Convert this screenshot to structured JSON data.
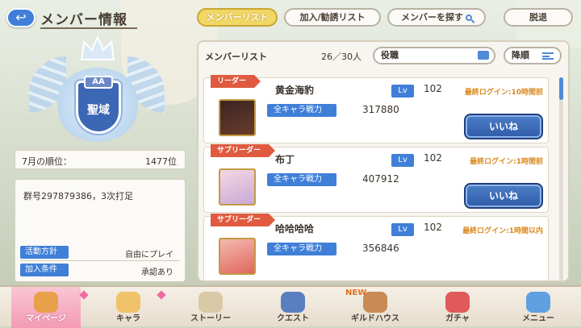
{
  "header": {
    "title": "メンバー情報",
    "tabs": [
      {
        "label": "メンバーリスト",
        "active": true
      },
      {
        "label": "加入/勧誘リスト",
        "active": false
      },
      {
        "label": "メンバーを探す",
        "active": false
      }
    ],
    "leave_label": "脱退"
  },
  "clan": {
    "grade": "AA",
    "rank_name": "聖域",
    "rank_label": "7月の順位：",
    "rank_value": "1477位",
    "description": "群号297879386，3次打足",
    "policy_label": "活動方針",
    "policy_value": "自由にプレイ",
    "condition_label": "加入条件",
    "condition_value": "承認あり"
  },
  "list": {
    "title": "メンバーリスト",
    "count": "26／30人",
    "filter_label": "役職",
    "sort_label": "降順",
    "scroll_position": 0.0,
    "members": [
      {
        "role": "リーダー",
        "name": "黄金海豹",
        "lv_label": "Lv",
        "level": "102",
        "power_label": "全キャラ戦力",
        "power": "317880",
        "login": "最終ログイン:10時間前",
        "like": "いいね",
        "avatar_colors": [
          "#3a2420",
          "#6a3c2c"
        ]
      },
      {
        "role": "サブリーダー",
        "name": "布丁",
        "lv_label": "Lv",
        "level": "102",
        "power_label": "全キャラ戦力",
        "power": "407912",
        "login": "最終ログイン:1時間前",
        "like": "いいね",
        "avatar_colors": [
          "#f3d7e3",
          "#c9a9d8"
        ]
      },
      {
        "role": "サブリーダー",
        "name": "哈哈哈哈",
        "lv_label": "Lv",
        "level": "102",
        "power_label": "全キャラ戦力",
        "power": "356846",
        "login": "最終ログイン:1時間以内",
        "like": "",
        "avatar_colors": [
          "#f4b9b0",
          "#e0675f"
        ]
      }
    ]
  },
  "nav": {
    "items": [
      {
        "label": "マイページ",
        "icon": "home-icon",
        "active": true,
        "color": "#e9a04a"
      },
      {
        "label": "キャラ",
        "icon": "character-icon",
        "active": false,
        "color": "#f0c26a"
      },
      {
        "label": "ストーリー",
        "icon": "scroll-icon",
        "active": false,
        "color": "#d9c9a6"
      },
      {
        "label": "クエスト",
        "icon": "swords-icon",
        "active": false,
        "color": "#5a7fc0"
      },
      {
        "label": "ギルドハウス",
        "icon": "door-icon",
        "active": false,
        "color": "#c98a55",
        "badge": "NEW"
      },
      {
        "label": "ガチャ",
        "icon": "gacha-icon",
        "active": false,
        "color": "#e05a5a"
      },
      {
        "label": "メニュー",
        "icon": "crystal-icon",
        "active": false,
        "color": "#5fa0e0"
      }
    ]
  }
}
